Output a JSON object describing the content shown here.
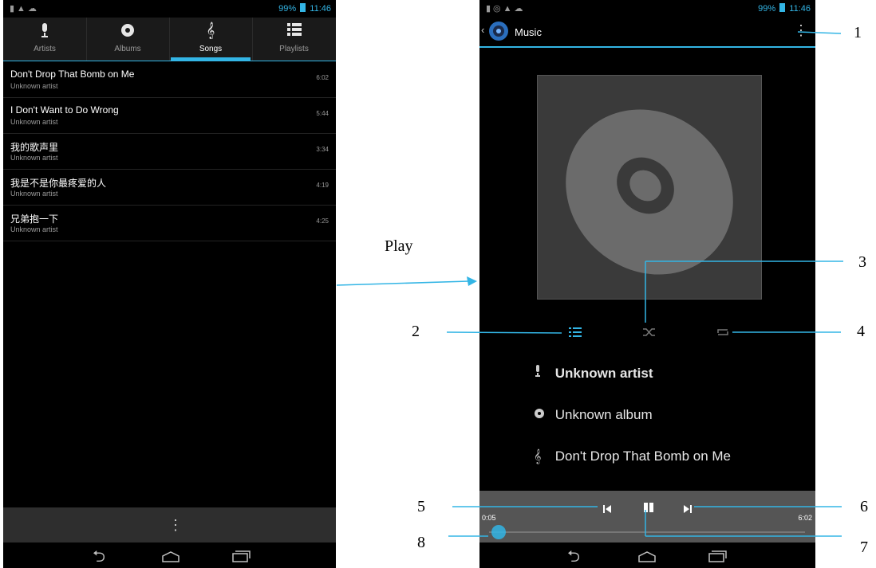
{
  "status": {
    "right_text": "99%",
    "time": "11:46"
  },
  "library": {
    "tabs": [
      {
        "label": "Artists",
        "icon": "mic-icon"
      },
      {
        "label": "Albums",
        "icon": "disc-icon"
      },
      {
        "label": "Songs",
        "icon": "note-icon"
      },
      {
        "label": "Playlists",
        "icon": "list-icon"
      }
    ],
    "active_tab": "Songs",
    "songs": [
      {
        "title": "Don't Drop That Bomb on Me",
        "artist": "Unknown artist",
        "duration": "6:02"
      },
      {
        "title": "I Don't Want to Do Wrong",
        "artist": "Unknown artist",
        "duration": "5:44"
      },
      {
        "title": "我的歌声里",
        "artist": "Unknown artist",
        "duration": "3:34"
      },
      {
        "title": "我是不是你最疼爱的人",
        "artist": "Unknown artist",
        "duration": "4:19"
      },
      {
        "title": "兄弟抱一下",
        "artist": "Unknown artist",
        "duration": "4:25"
      }
    ]
  },
  "player": {
    "title": "Music",
    "artist": "Unknown artist",
    "album": "Unknown album",
    "track": "Don't Drop That Bomb on Me",
    "elapsed": "0:05",
    "total": "6:02",
    "progress_fraction": 0.014
  },
  "annotation": {
    "play_label": "Play",
    "callouts": [
      "1",
      "2",
      "3",
      "4",
      "5",
      "6",
      "7",
      "8"
    ]
  },
  "colors": {
    "accent": "#33b5e5",
    "background": "#000000",
    "panel": "#555555"
  }
}
